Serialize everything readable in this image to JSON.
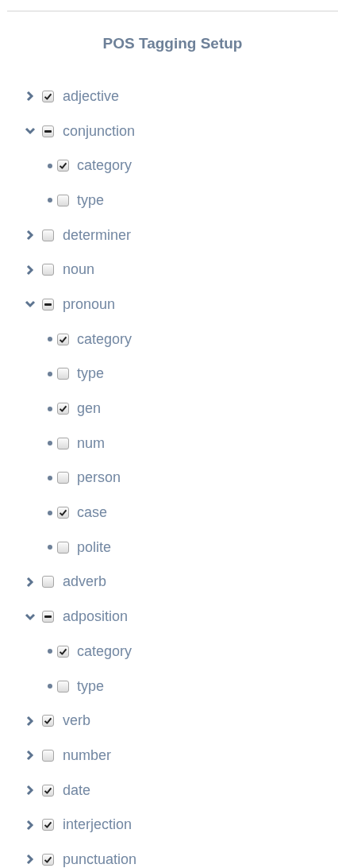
{
  "title": "POS Tagging Setup",
  "tree": [
    {
      "label": "adjective",
      "checked": true,
      "mixed": false,
      "expanded": false
    },
    {
      "label": "conjunction",
      "checked": false,
      "mixed": true,
      "expanded": true,
      "children": [
        {
          "label": "category",
          "checked": true
        },
        {
          "label": "type",
          "checked": false
        }
      ]
    },
    {
      "label": "determiner",
      "checked": false,
      "mixed": false,
      "expanded": false
    },
    {
      "label": "noun",
      "checked": false,
      "mixed": false,
      "expanded": false
    },
    {
      "label": "pronoun",
      "checked": false,
      "mixed": true,
      "expanded": true,
      "children": [
        {
          "label": "category",
          "checked": true
        },
        {
          "label": "type",
          "checked": false
        },
        {
          "label": "gen",
          "checked": true
        },
        {
          "label": "num",
          "checked": false
        },
        {
          "label": "person",
          "checked": false
        },
        {
          "label": "case",
          "checked": true
        },
        {
          "label": "polite",
          "checked": false
        }
      ]
    },
    {
      "label": "adverb",
      "checked": false,
      "mixed": false,
      "expanded": false
    },
    {
      "label": "adposition",
      "checked": false,
      "mixed": true,
      "expanded": true,
      "children": [
        {
          "label": "category",
          "checked": true
        },
        {
          "label": "type",
          "checked": false
        }
      ]
    },
    {
      "label": "verb",
      "checked": true,
      "mixed": false,
      "expanded": false
    },
    {
      "label": "number",
      "checked": false,
      "mixed": false,
      "expanded": false
    },
    {
      "label": "date",
      "checked": true,
      "mixed": false,
      "expanded": false
    },
    {
      "label": "interjection",
      "checked": true,
      "mixed": false,
      "expanded": false
    },
    {
      "label": "punctuation",
      "checked": true,
      "mixed": false,
      "expanded": false
    }
  ]
}
